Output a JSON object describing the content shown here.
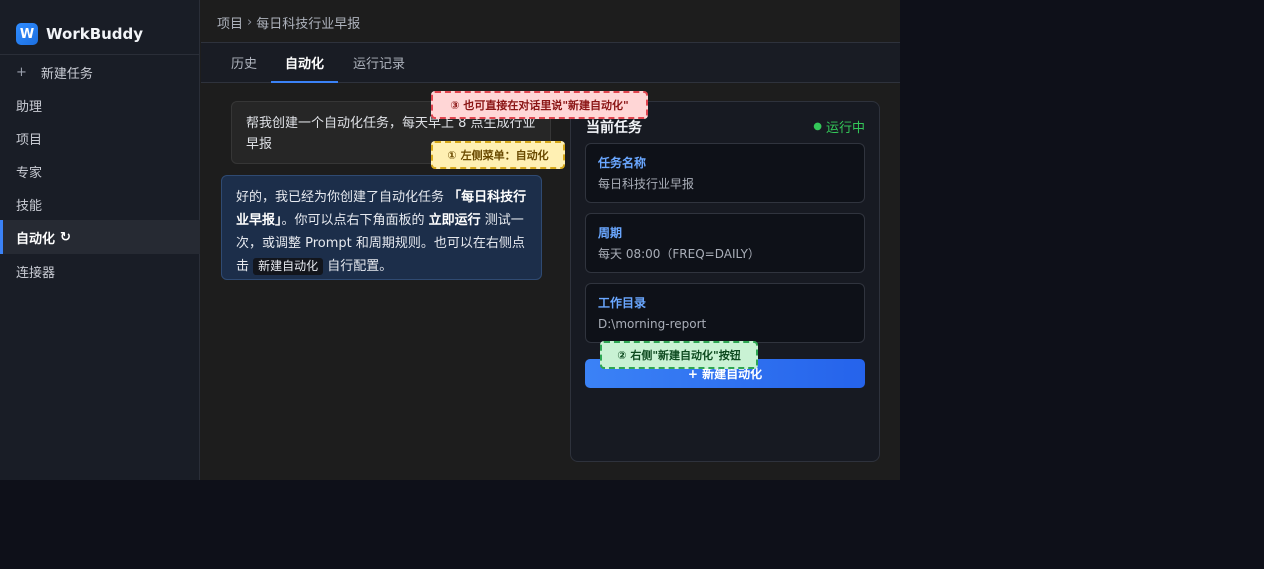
{
  "brand": {
    "logo_letter": "W",
    "name": "WorkBuddy"
  },
  "sidebar": {
    "new_task": {
      "icon": "+",
      "label": "新建任务"
    },
    "items": [
      {
        "label": "助理"
      },
      {
        "label": "项目"
      },
      {
        "label": "专家"
      },
      {
        "label": "技能"
      },
      {
        "label": "自动化",
        "icon": "↻",
        "active": true
      },
      {
        "label": "连接器"
      }
    ]
  },
  "breadcrumb": {
    "parent": "项目",
    "separator": "›",
    "current": "每日科技行业早报"
  },
  "tabs": [
    {
      "label": "历史"
    },
    {
      "label": "自动化",
      "active": true
    },
    {
      "label": "运行记录"
    }
  ],
  "chat": {
    "user_message": "帮我创建一个自动化任务，每天早上 8 点生成行业早报",
    "bot_message": {
      "part1": "好的，我已经为你创建了自动化任务 ",
      "task_name": "「每日科技行业早报」",
      "part2": "。你可以点右下角面板的 ",
      "run_now": "立即运行",
      "part3": " 测试一次，或调整 Prompt 和周期规则。也可以在右侧点击 ",
      "chip": "新建自动化",
      "part4": " 自行配置。"
    }
  },
  "panel": {
    "title": "当前任务",
    "status": "运行中",
    "status_color": "#34c759",
    "cards": [
      {
        "label": "任务名称",
        "value": "每日科技行业早报"
      },
      {
        "label": "周期",
        "value": "每天 08:00（FREQ=DAILY）"
      },
      {
        "label": "工作目录",
        "value": "D:\\morning-report"
      }
    ],
    "new_button": "+ 新建自动化"
  },
  "annotations": {
    "note3": "③ 也可直接在对话里说\"新建自动化\"",
    "note1": "① 左侧菜单：自动化",
    "note2": "② 右侧\"新建自动化\"按钮"
  },
  "colors": {
    "accent": "#3b82f6",
    "card_label": "#6aa7ff"
  }
}
